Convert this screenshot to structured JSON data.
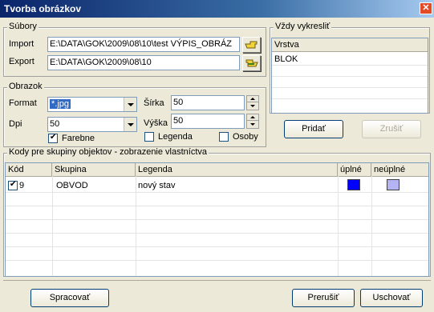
{
  "window": {
    "title": "Tvorba obrázkov"
  },
  "subory": {
    "legend": "Súbory",
    "import_label": "Import",
    "import_value": "E:\\DATA\\GOK\\2009\\08\\10\\test VÝPIS_OBRÁZ",
    "export_label": "Export",
    "export_value": "E:\\DATA\\GOK\\2009\\08\\10"
  },
  "obrazok": {
    "legend": "Obrazok",
    "format_label": "Format",
    "format_value": "*.jpg",
    "dpi_label": "Dpi",
    "dpi_value": "50",
    "sirka_label": "Šírka",
    "sirka_value": "50",
    "vyska_label": "Výška",
    "vyska_value": "50",
    "farebne_label": "Farebne",
    "farebne_checked": true,
    "legenda_label": "Legenda",
    "legenda_checked": false,
    "osoby_label": "Osoby",
    "osoby_checked": false
  },
  "vzdy": {
    "legend": "Vždy vykresliť",
    "column": "Vrstva",
    "rows": [
      "BLOK"
    ],
    "pridat_label": "Pridať",
    "zrusit_label": "Zrušiť"
  },
  "kody": {
    "legend": "Kody pre skupiny objektov - zobrazenie vlastníctva",
    "columns": [
      "Kód",
      "Skupina",
      "Legenda",
      "úplné",
      "neúplné"
    ],
    "rows": [
      {
        "kod": "9",
        "checked": true,
        "skupina": "OBVOD",
        "legenda": "nový stav",
        "uplne_color": "#0000ff",
        "neuplne_color": "#b4b4f4"
      }
    ]
  },
  "buttons": {
    "spracovat": "Spracovať",
    "prerusit": "Prerušiť",
    "uschovat": "Uschovať"
  }
}
